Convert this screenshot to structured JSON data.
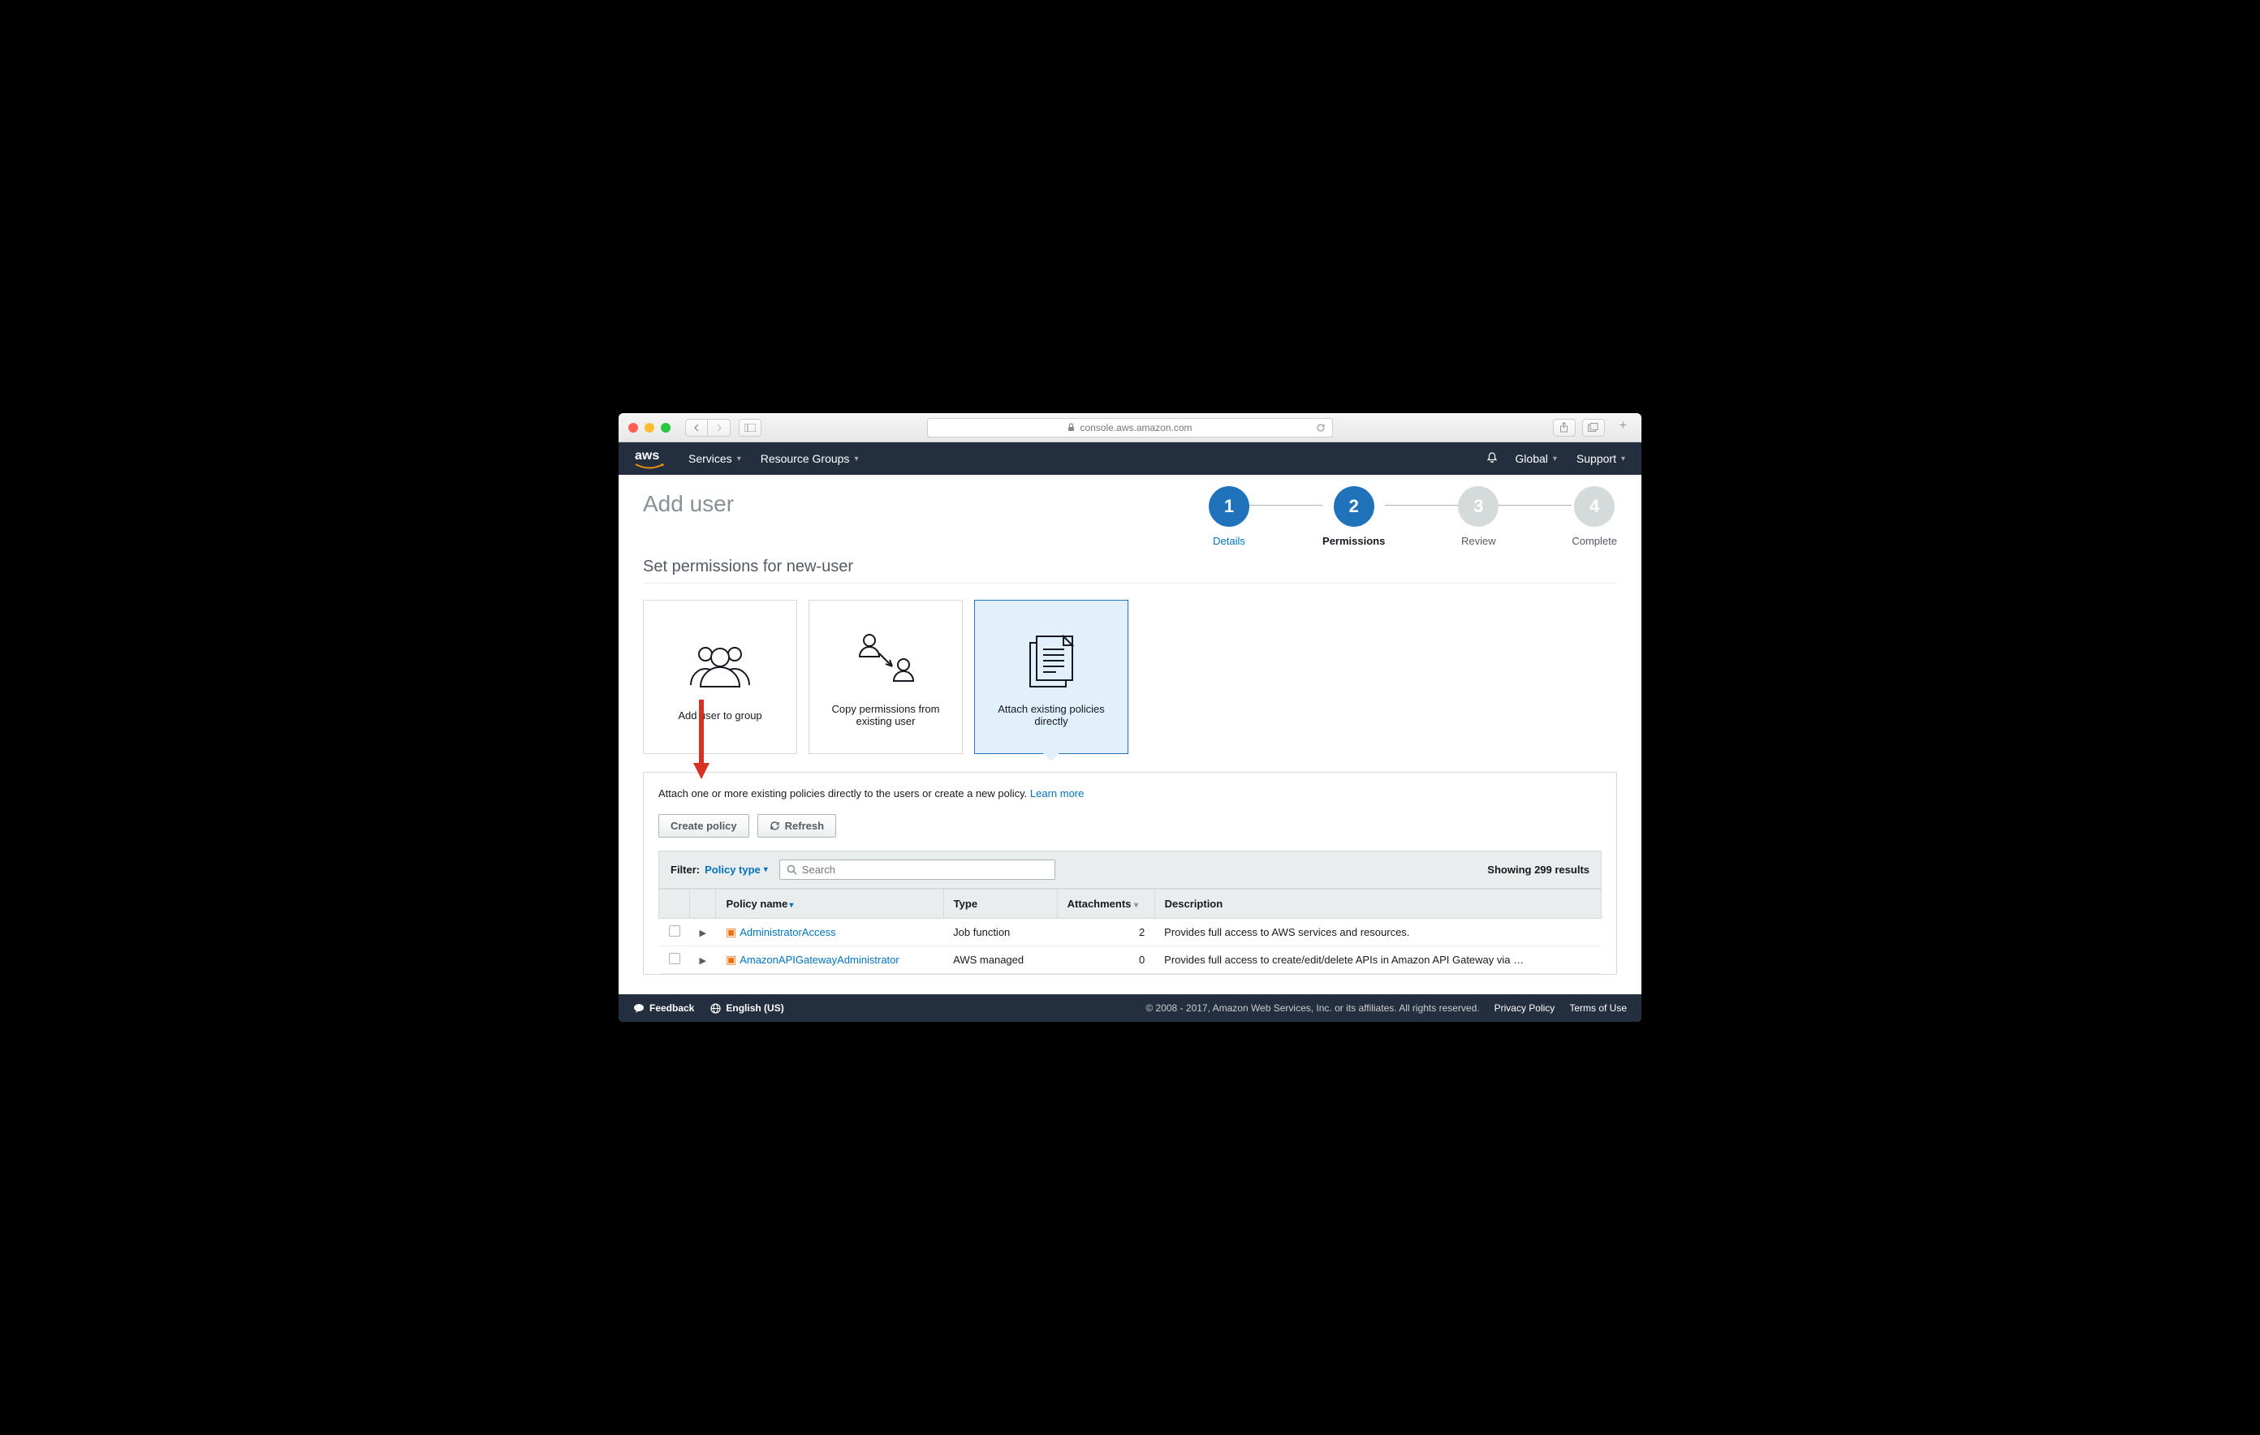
{
  "browser": {
    "url": "console.aws.amazon.com"
  },
  "nav": {
    "logo": "aws",
    "services": "Services",
    "resource_groups": "Resource Groups",
    "region": "Global",
    "support": "Support"
  },
  "page": {
    "title": "Add user",
    "section_title": "Set permissions for new-user"
  },
  "wizard": [
    {
      "num": "1",
      "label": "Details",
      "state": "done"
    },
    {
      "num": "2",
      "label": "Permissions",
      "state": "current"
    },
    {
      "num": "3",
      "label": "Review",
      "state": "pending"
    },
    {
      "num": "4",
      "label": "Complete",
      "state": "pending"
    }
  ],
  "cards": {
    "group": "Add user to group",
    "copy": "Copy permissions from existing user",
    "attach": "Attach existing policies directly"
  },
  "policy": {
    "help": "Attach one or more existing policies directly to the users or create a new policy. ",
    "learn": "Learn more",
    "create_btn": "Create policy",
    "refresh_btn": "Refresh",
    "filter_label": "Filter:",
    "filter_type": "Policy type",
    "search_placeholder": "Search",
    "results": "Showing 299 results",
    "cols": {
      "name": "Policy name",
      "type": "Type",
      "attachments": "Attachments",
      "description": "Description"
    },
    "rows": [
      {
        "name": "AdministratorAccess",
        "type": "Job function",
        "attachments": "2",
        "desc": "Provides full access to AWS services and resources."
      },
      {
        "name": "AmazonAPIGatewayAdministrator",
        "type": "AWS managed",
        "attachments": "0",
        "desc": "Provides full access to create/edit/delete APIs in Amazon API Gateway via …"
      }
    ]
  },
  "footer": {
    "feedback": "Feedback",
    "lang": "English (US)",
    "copyright": "© 2008 - 2017, Amazon Web Services, Inc. or its affiliates. All rights reserved.",
    "privacy": "Privacy Policy",
    "terms": "Terms of Use"
  }
}
